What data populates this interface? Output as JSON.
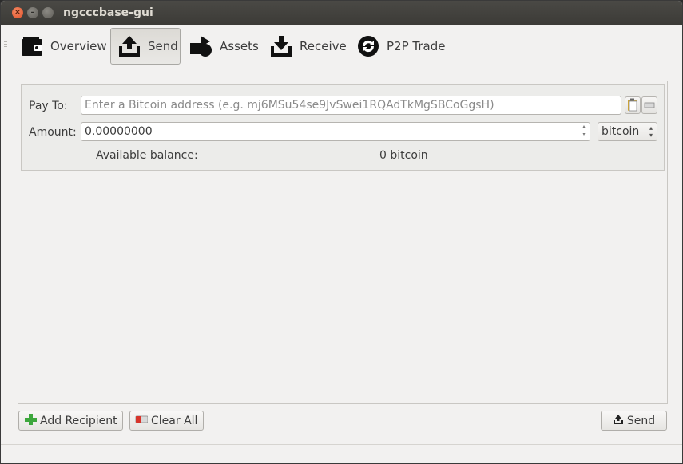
{
  "window": {
    "title": "ngcccbase-gui"
  },
  "toolbar": {
    "items": [
      {
        "label": "Overview",
        "icon": "wallet-icon"
      },
      {
        "label": "Send",
        "icon": "send-icon",
        "active": true
      },
      {
        "label": "Assets",
        "icon": "assets-icon"
      },
      {
        "label": "Receive",
        "icon": "receive-icon"
      },
      {
        "label": "P2P Trade",
        "icon": "p2p-trade-icon"
      }
    ]
  },
  "send_form": {
    "pay_to_label": "Pay To:",
    "pay_to_placeholder": "Enter a Bitcoin address (e.g. mj6MSu54se9JvSwei1RQAdTkMgSBCoGgsH)",
    "amount_label": "Amount:",
    "amount_value": "0.00000000",
    "unit": "bitcoin",
    "balance_label": "Available balance:",
    "balance_value": "0 bitcoin"
  },
  "actions": {
    "add_recipient": "Add Recipient",
    "clear_all": "Clear All",
    "send": "Send"
  },
  "colors": {
    "titlebar": "#3c3b37",
    "close_button": "#e0502a",
    "window_bg": "#f2f1f0"
  }
}
